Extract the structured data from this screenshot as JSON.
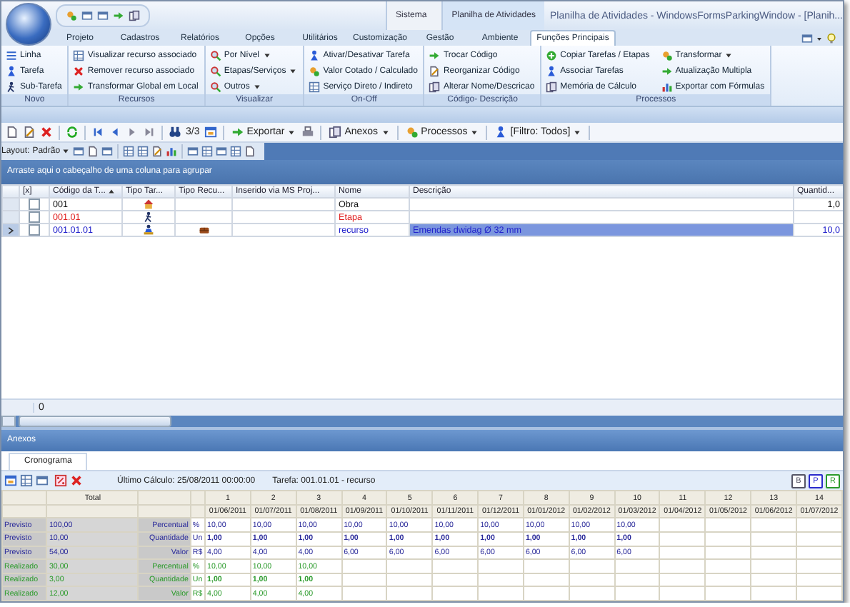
{
  "window": {
    "title": "Planilha de Atividades - WindowsFormsParkingWindow - [Planih...",
    "context_tabs": [
      "Sistema",
      "Planilha de Atividades"
    ]
  },
  "ribbon": {
    "tabs": [
      {
        "label": "Projeto",
        "selected": false
      },
      {
        "label": "Cadastros",
        "selected": false
      },
      {
        "label": "Relatórios",
        "selected": false
      },
      {
        "label": "Opções",
        "selected": false
      },
      {
        "label": "Utilitários",
        "selected": false
      },
      {
        "label": "Customização",
        "selected": false
      },
      {
        "label": "Gestão",
        "selected": false
      },
      {
        "label": "Ambiente",
        "selected": false
      },
      {
        "label": "Funções Principais",
        "selected": true
      }
    ],
    "groups": [
      {
        "title": "Novo",
        "items": [
          {
            "label": "Linha",
            "dropdown": false
          },
          {
            "label": "Tarefa",
            "dropdown": false
          },
          {
            "label": "Sub-Tarefa",
            "dropdown": false
          }
        ]
      },
      {
        "title": "Recursos",
        "items": [
          {
            "label": "Visualizar recurso associado",
            "dropdown": false
          },
          {
            "label": "Remover recurso associado",
            "dropdown": false
          },
          {
            "label": "Transformar Global em Local",
            "dropdown": false
          }
        ]
      },
      {
        "title": "Visualizar",
        "items": [
          {
            "label": "Por Nível",
            "dropdown": true
          },
          {
            "label": "Etapas/Serviços",
            "dropdown": true
          },
          {
            "label": "Outros",
            "dropdown": true
          }
        ]
      },
      {
        "title": "On-Off",
        "items": [
          {
            "label": "Ativar/Desativar Tarefa",
            "dropdown": false
          },
          {
            "label": "Valor Cotado / Calculado",
            "dropdown": false
          },
          {
            "label": "Serviço Direto / Indireto",
            "dropdown": false
          }
        ]
      },
      {
        "title": "Código- Descrição",
        "items": [
          {
            "label": "Trocar Código",
            "dropdown": false
          },
          {
            "label": "Reorganizar Código",
            "dropdown": false
          },
          {
            "label": "Alterar Nome/Descricao",
            "dropdown": false
          }
        ]
      },
      {
        "title": "Processos",
        "items": [
          {
            "label": "Copiar Tarefas / Etapas",
            "dropdown": false
          },
          {
            "label": "Associar Tarefas",
            "dropdown": false
          },
          {
            "label": "Memória de Cálculo",
            "dropdown": false
          },
          {
            "label": "Transformar",
            "dropdown": true
          },
          {
            "label": "Atualização Multipla",
            "dropdown": false
          },
          {
            "label": "Exportar com Fórmulas",
            "dropdown": false
          }
        ]
      }
    ]
  },
  "toolbar": {
    "page": "3/3",
    "buttons": [
      {
        "label": "Exportar",
        "dropdown": true
      },
      {
        "label": "Anexos",
        "dropdown": true
      },
      {
        "label": "Processos",
        "dropdown": true
      },
      {
        "label": "[Filtro: Todos]",
        "dropdown": true
      }
    ]
  },
  "layout_bar": {
    "label": "Layout:",
    "value": "Padrão"
  },
  "group_panel": {
    "hint": "Arraste aqui o cabeçalho de uma coluna para agrupar"
  },
  "task_grid": {
    "columns": [
      {
        "label": "[x]",
        "sorted": false
      },
      {
        "label": "Código da T...",
        "sorted": true
      },
      {
        "label": "Tipo Tar...",
        "sorted": false
      },
      {
        "label": "Tipo Recu...",
        "sorted": false
      },
      {
        "label": "Inserido via MS Proj...",
        "sorted": false
      },
      {
        "label": "Nome",
        "sorted": false
      },
      {
        "label": "Descrição",
        "sorted": false
      },
      {
        "label": "Quantid...",
        "sorted": false
      }
    ],
    "rows": [
      {
        "kind": "obra",
        "selected": false,
        "checked": false,
        "code": "001",
        "name": "Obra",
        "quantity": "1,0"
      },
      {
        "kind": "etapa",
        "selected": false,
        "checked": false,
        "code": "001.01",
        "name": "Etapa"
      },
      {
        "kind": "recurso",
        "selected": true,
        "checked": false,
        "code": "001.01.01",
        "name": "recurso",
        "description": "Emendas dwidag Ø 32 mm",
        "quantity": "10,0"
      }
    ],
    "footer": "0"
  },
  "attachments": {
    "title": "Anexos",
    "tabs": [
      {
        "label": "Cronograma",
        "selected": true
      }
    ],
    "last_calc": "Último Cálculo: 25/08/2011 00:00:00",
    "task": "Tarefa: 001.01.01 - recurso",
    "view_buttons": [
      "B",
      "P",
      "R"
    ]
  },
  "schedule": {
    "total_label": "Total",
    "periods": [
      {
        "number": "1",
        "date": "01/06/2011"
      },
      {
        "number": "2",
        "date": "01/07/2011"
      },
      {
        "number": "3",
        "date": "01/08/2011"
      },
      {
        "number": "4",
        "date": "01/09/2011"
      },
      {
        "number": "5",
        "date": "01/10/2011"
      },
      {
        "number": "6",
        "date": "01/11/2011"
      },
      {
        "number": "7",
        "date": "01/12/2011"
      },
      {
        "number": "8",
        "date": "01/01/2012"
      },
      {
        "number": "9",
        "date": "01/02/2012"
      },
      {
        "number": "10",
        "date": "01/03/2012"
      },
      {
        "number": "11",
        "date": "01/04/2012"
      },
      {
        "number": "12",
        "date": "01/05/2012"
      },
      {
        "number": "13",
        "date": "01/06/2012"
      },
      {
        "number": "14",
        "date": "01/07/2012"
      }
    ],
    "rows": [
      {
        "kind": "previsto",
        "bold": false,
        "label": "Previsto",
        "total": "100,00",
        "measure": "Percentual",
        "unit": "%",
        "values": [
          "10,00",
          "10,00",
          "10,00",
          "10,00",
          "10,00",
          "10,00",
          "10,00",
          "10,00",
          "10,00",
          "10,00"
        ]
      },
      {
        "kind": "previsto",
        "bold": true,
        "label": "Previsto",
        "total": "10,00",
        "measure": "Quantidade",
        "unit": "Un",
        "values": [
          "1,00",
          "1,00",
          "1,00",
          "1,00",
          "1,00",
          "1,00",
          "1,00",
          "1,00",
          "1,00",
          "1,00"
        ]
      },
      {
        "kind": "previsto",
        "bold": false,
        "label": "Previsto",
        "total": "54,00",
        "measure": "Valor",
        "unit": "R$",
        "values": [
          "4,00",
          "4,00",
          "4,00",
          "6,00",
          "6,00",
          "6,00",
          "6,00",
          "6,00",
          "6,00",
          "6,00"
        ]
      },
      {
        "kind": "realizado",
        "bold": false,
        "label": "Realizado",
        "total": "30,00",
        "measure": "Percentual",
        "unit": "%",
        "values": [
          "10,00",
          "10,00",
          "10,00"
        ]
      },
      {
        "kind": "realizado",
        "bold": true,
        "label": "Realizado",
        "total": "3,00",
        "measure": "Quantidade",
        "unit": "Un",
        "values": [
          "1,00",
          "1,00",
          "1,00"
        ]
      },
      {
        "kind": "realizado",
        "bold": false,
        "label": "Realizado",
        "total": "12,00",
        "measure": "Valor",
        "unit": "R$",
        "values": [
          "4,00",
          "4,00",
          "4,00"
        ]
      }
    ]
  }
}
